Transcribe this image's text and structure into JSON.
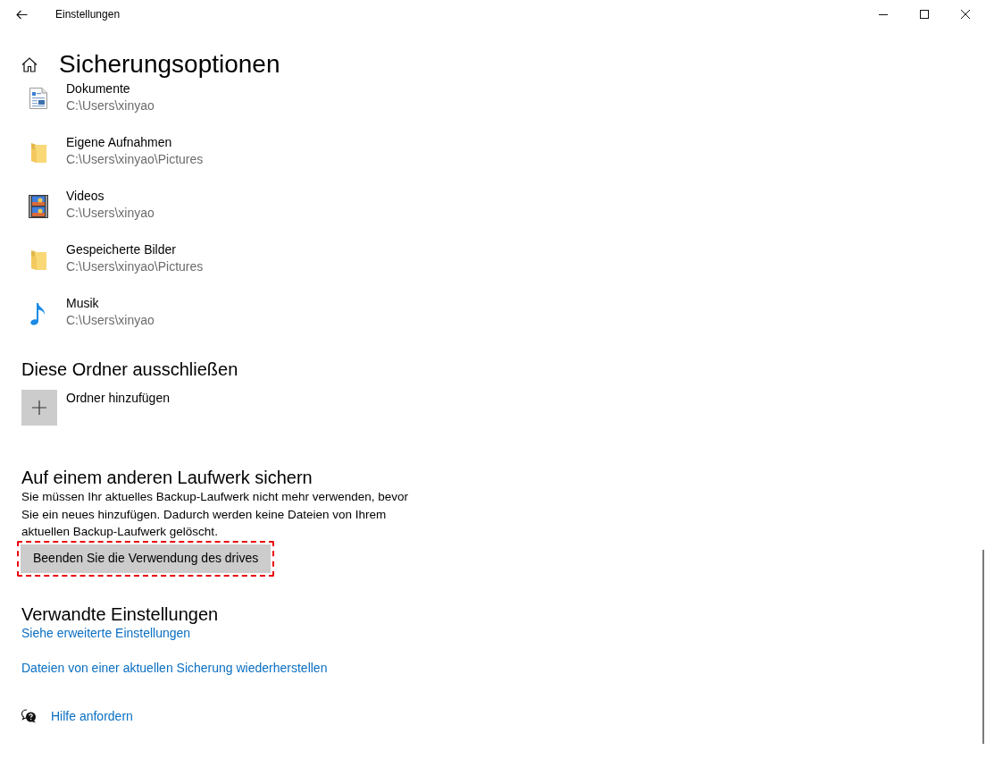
{
  "window": {
    "title": "Einstellungen"
  },
  "page": {
    "title": "Sicherungsoptionen"
  },
  "folders": [
    {
      "kind": "document",
      "name": "Dokumente",
      "path": "C:\\Users\\xinyao"
    },
    {
      "kind": "folder",
      "name": "Eigene Aufnahmen",
      "path": "C:\\Users\\xinyao\\Pictures"
    },
    {
      "kind": "video",
      "name": "Videos",
      "path": "C:\\Users\\xinyao"
    },
    {
      "kind": "folder",
      "name": "Gespeicherte Bilder",
      "path": "C:\\Users\\xinyao\\Pictures"
    },
    {
      "kind": "music",
      "name": "Musik",
      "path": "C:\\Users\\xinyao"
    }
  ],
  "exclude_section": {
    "heading": "Diese Ordner ausschließen",
    "add_label": "Ordner hinzufügen"
  },
  "drive_section": {
    "heading": "Auf einem anderen Laufwerk sichern",
    "description": "Sie müssen Ihr aktuelles Backup-Laufwerk nicht mehr verwenden, bevor Sie ein neues hinzufügen. Dadurch werden keine Dateien von Ihrem aktuellen Backup-Laufwerk gelöscht.",
    "button": {
      "label": "Beenden Sie die Verwendung des drives",
      "highlighted": true
    }
  },
  "related_section": {
    "heading": "Verwandte Einstellungen",
    "links": [
      "Siehe erweiterte Einstellungen",
      "Dateien von einer aktuellen Sicherung wiederherstellen"
    ]
  },
  "help": {
    "label": "Hilfe anfordern"
  }
}
